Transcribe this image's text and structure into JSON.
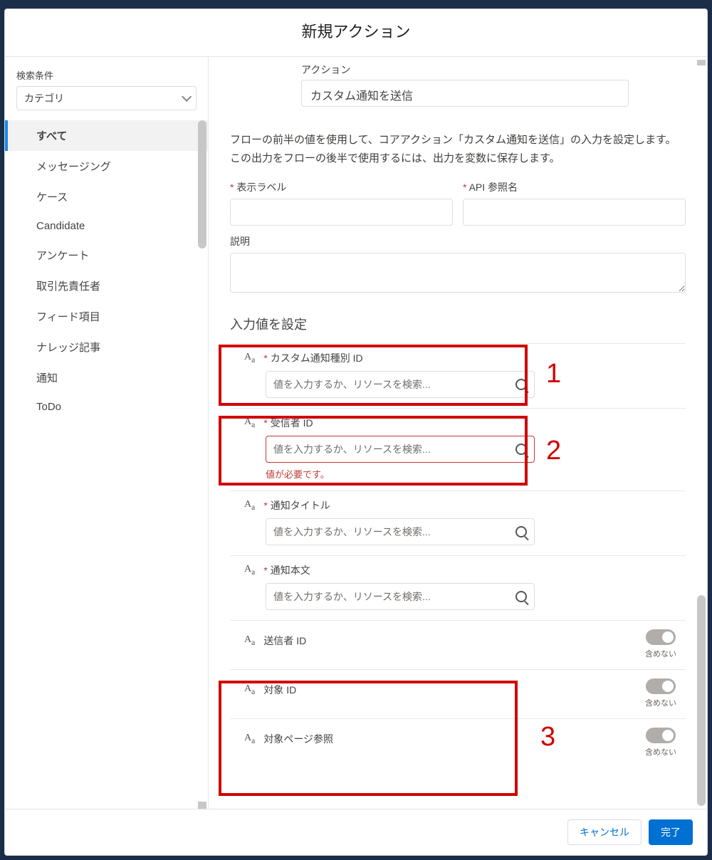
{
  "title": "新規アクション",
  "sidebar": {
    "label": "検索条件",
    "selected": "カテゴリ",
    "categories": [
      "すべて",
      "メッセージング",
      "ケース",
      "Candidate",
      "アンケート",
      "取引先責任者",
      "フィード項目",
      "ナレッジ記事",
      "通知",
      "ToDo"
    ]
  },
  "action": {
    "label": "アクション",
    "value": "カスタム通知を送信"
  },
  "description": "フローの前半の値を使用して、コアアクション「カスタム通知を送信」の入力を設定します。この出力をフローの後半で使用するには、出力を変数に保存します。",
  "fields": {
    "display_label": "表示ラベル",
    "api_name": "API 参照名",
    "desc_label": "説明"
  },
  "section_title": "入力値を設定",
  "placeholder": "値を入力するか、リソースを検索...",
  "inputs": {
    "notif_type": "カスタム通知種別 ID",
    "recipient": "受信者 ID",
    "title": "通知タイトル",
    "body": "通知本文",
    "sender": "送信者 ID",
    "target_id": "対象 ID",
    "target_page": "対象ページ参照"
  },
  "error_msg": "値が必要です。",
  "toggle_label": "含めない",
  "callouts": {
    "n1": "1",
    "n2": "2",
    "n3": "3"
  },
  "footer": {
    "cancel": "キャンセル",
    "done": "完了"
  }
}
